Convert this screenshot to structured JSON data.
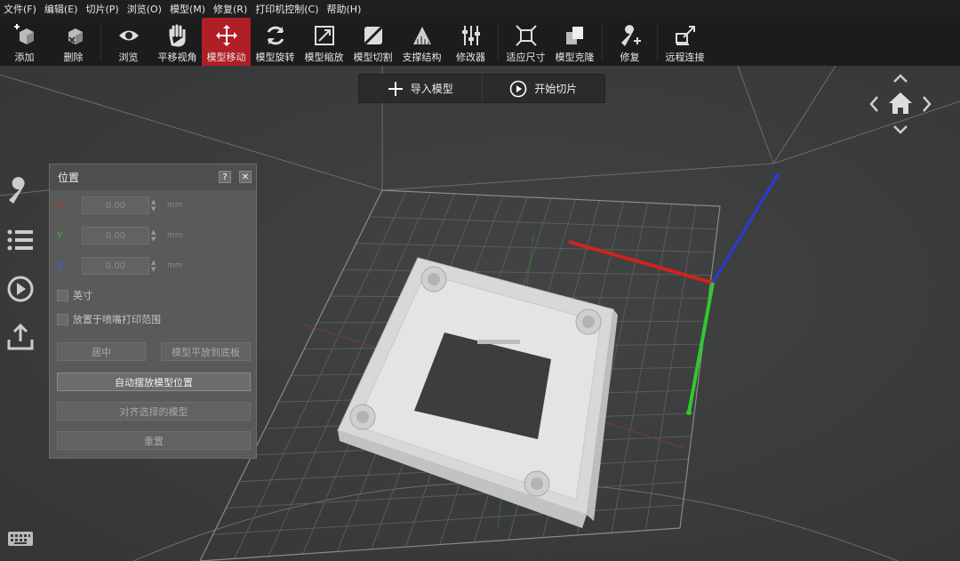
{
  "menu": [
    "文件(F)",
    "编辑(E)",
    "切片(P)",
    "浏览(O)",
    "模型(M)",
    "修复(R)",
    "打印机控制(C)",
    "帮助(H)"
  ],
  "toolbar": [
    {
      "label": "添加",
      "icon": "add-cube-icon",
      "active": false
    },
    {
      "label": "删除",
      "icon": "delete-cube-icon",
      "active": false
    },
    {
      "label": "浏览",
      "icon": "eye-icon",
      "active": false
    },
    {
      "label": "平移视角",
      "icon": "hand-icon",
      "active": false
    },
    {
      "label": "模型移动",
      "icon": "move-arrows-icon",
      "active": true
    },
    {
      "label": "模型旋转",
      "icon": "rotate-icon",
      "active": false
    },
    {
      "label": "模型缩放",
      "icon": "scale-icon",
      "active": false
    },
    {
      "label": "模型切割",
      "icon": "cut-icon",
      "active": false
    },
    {
      "label": "支撑结构",
      "icon": "support-icon",
      "active": false
    },
    {
      "label": "修改器",
      "icon": "sliders-icon",
      "active": false
    },
    {
      "label": "适应尺寸",
      "icon": "fit-size-icon",
      "active": false
    },
    {
      "label": "模型克隆",
      "icon": "clone-icon",
      "active": false
    },
    {
      "label": "修复",
      "icon": "wrench-plus-icon",
      "active": false
    },
    {
      "label": "远程连接",
      "icon": "remote-connect-icon",
      "active": false
    }
  ],
  "top_buttons": {
    "import": "导入模型",
    "slice": "开始切片"
  },
  "panel": {
    "title": "位置",
    "help": "?",
    "close": "✕",
    "axes": [
      {
        "name": "X",
        "value": "0.00",
        "unit": "mm",
        "color": "#d03030"
      },
      {
        "name": "Y",
        "value": "0.00",
        "unit": "mm",
        "color": "#30c030"
      },
      {
        "name": "Z",
        "value": "0.00",
        "unit": "mm",
        "color": "#3060ff"
      }
    ],
    "checkboxes": [
      "英寸",
      "放置于喷嘴打印范围"
    ],
    "center_btn": "居中",
    "lay_flat_btn": "模型平放到底板",
    "auto_arrange_btn": "自动摆放模型位置",
    "align_btn": "对齐选择的模型",
    "reset_btn": "重置"
  },
  "sidebar_icons": [
    "wrench-icon",
    "list-icon",
    "play-icon",
    "upload-icon"
  ]
}
